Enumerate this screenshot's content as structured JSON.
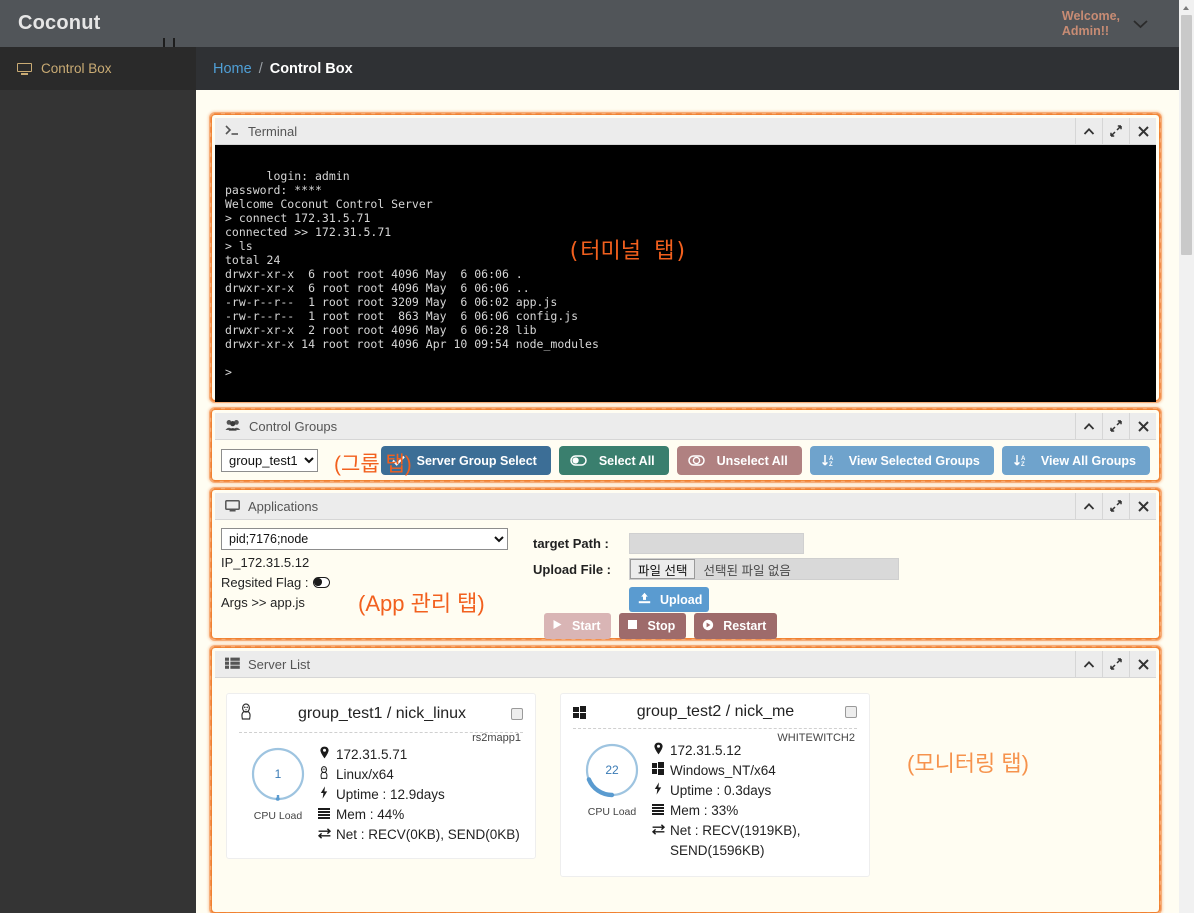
{
  "topbar": {
    "brand": "Coconut",
    "welcome": "Welcome,\nAdmin!!",
    "caret_icon": "chevron-down-icon"
  },
  "sidebar": {
    "items": [
      {
        "label": "Control Box",
        "icon": "monitor-icon"
      }
    ]
  },
  "breadcrumb": {
    "home": "Home",
    "separator": "/",
    "current": "Control Box"
  },
  "annotations": {
    "terminal": "(터미널 탭)",
    "groups": "(그룹 탭)",
    "apps": "(App 관리 탭)",
    "monitoring": "(모니터링 탭)",
    "color": "#f2601e",
    "color_light": "#f6934d"
  },
  "panel_tools": {
    "collapse": "collapse-icon",
    "expand": "expand-icon",
    "close": "close-icon"
  },
  "terminal": {
    "title": "Terminal",
    "icon": "prompt-icon",
    "lines": "login: admin\npassword: ****\nWelcome Coconut Control Server\n> connect 172.31.5.71\nconnected >> 172.31.5.71\n> ls\ntotal 24\ndrwxr-xr-x  6 root root 4096 May  6 06:06 .\ndrwxr-xr-x  6 root root 4096 May  6 06:06 ..\n-rw-r--r--  1 root root 3209 May  6 06:02 app.js\n-rw-r--r--  1 root root  863 May  6 06:06 config.js\ndrwxr-xr-x  2 root root 4096 May  6 06:28 lib\ndrwxr-xr-x 14 root root 4096 Apr 10 09:54 node_modules\n\n>"
  },
  "groups": {
    "title": "Control Groups",
    "icon": "users-icon",
    "select_value": "group_test1",
    "select_options": [
      "group_test1"
    ],
    "buttons": [
      {
        "label": "Server Group Select",
        "icon": "check-icon",
        "color": "#3c6e96"
      },
      {
        "label": "Select All",
        "icon": "toggle-on-icon",
        "color": "#3a7f6e"
      },
      {
        "label": "Unselect All",
        "icon": "toggle-off-icon",
        "color": "#b08181"
      },
      {
        "label": "View Selected Groups",
        "icon": "sort-az-icon",
        "color": "#6fa3cc"
      },
      {
        "label": "View All Groups",
        "icon": "sort-az-icon",
        "color": "#6fa3cc"
      }
    ]
  },
  "apps": {
    "title": "Applications",
    "icon": "monitor-icon",
    "select_value": "pid;7176;node",
    "select_options": [
      "pid;7176;node"
    ],
    "ip_line": "IP_172.31.5.12",
    "flag_label": "Regsited Flag :",
    "flag_value": "on",
    "args_line": "Args >> app.js",
    "target_path_label": "target Path :",
    "target_path_value": "",
    "upload_file_label": "Upload File :",
    "file_button": "파일 선택",
    "file_status": "선택된 파일 없음",
    "upload_button": "Upload",
    "upload_icon": "upload-icon",
    "actions": [
      {
        "label": "Start",
        "icon": "play-icon",
        "state": "disabled"
      },
      {
        "label": "Stop",
        "icon": "square-icon",
        "state": "enabled"
      },
      {
        "label": "Restart",
        "icon": "restart-icon",
        "state": "enabled"
      }
    ]
  },
  "servers": {
    "title": "Server List",
    "icon": "list-icon",
    "cpu_label": "CPU Load",
    "cards": [
      {
        "os_icon": "linux-penguin-icon",
        "title": "group_test1 / nick_linux",
        "checkbox": "unchecked",
        "hostname": "rs2mapp1",
        "cpu": "1",
        "cpu_percent": 1,
        "ip": "172.31.5.71",
        "os": "Linux/x64",
        "uptime": "Uptime : 12.9days",
        "mem": "Mem : 44%",
        "net": "Net : RECV(0KB), SEND(0KB)"
      },
      {
        "os_icon": "windows-logo-icon",
        "title": "group_test2 / nick_me",
        "checkbox": "unchecked",
        "hostname": "WHITEWITCH2",
        "cpu": "22",
        "cpu_percent": 22,
        "ip": "172.31.5.12",
        "os": "Windows_NT/x64",
        "uptime": "Uptime : 0.3days",
        "mem": "Mem : 33%",
        "net": "Net : RECV(1919KB), SEND(1596KB)"
      }
    ]
  }
}
